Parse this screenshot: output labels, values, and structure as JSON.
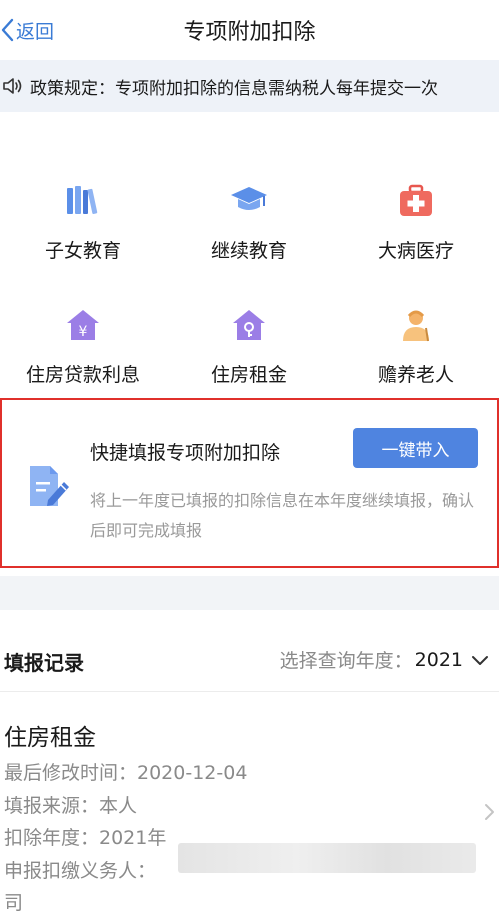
{
  "nav": {
    "back_label": "返回",
    "title": "专项附加扣除"
  },
  "notice": {
    "text": "政策规定：专项附加扣除的信息需纳税人每年提交一次"
  },
  "categories": [
    {
      "label": "子女教育",
      "icon": "books-icon"
    },
    {
      "label": "继续教育",
      "icon": "graduation-cap-icon"
    },
    {
      "label": "大病医疗",
      "icon": "medical-kit-icon"
    },
    {
      "label": "住房贷款利息",
      "icon": "house-yen-icon"
    },
    {
      "label": "住房租金",
      "icon": "house-key-icon"
    },
    {
      "label": "赡养老人",
      "icon": "elderly-person-icon"
    }
  ],
  "quick_fill": {
    "title": "快捷填报专项附加扣除",
    "button_label": "一键带入",
    "description": "将上一年度已填报的扣除信息在本年度继续填报，确认后即可完成填报",
    "icon": "edit-document-icon"
  },
  "records": {
    "title": "填报记录",
    "year_label": "选择查询年度：",
    "year_value": "2021",
    "items": [
      {
        "name": "住房租金",
        "modified": "最后修改时间：2020-12-04",
        "source": "填报来源：本人",
        "year": "扣除年度：2021年",
        "withholder_label": "申报扣缴义务人：",
        "withholder_tail": "司"
      }
    ]
  },
  "colors": {
    "accent": "#4f84e0",
    "back_link": "#3a7bd5",
    "highlight_border": "#e0302b",
    "notice_bg": "#eef2f8"
  }
}
